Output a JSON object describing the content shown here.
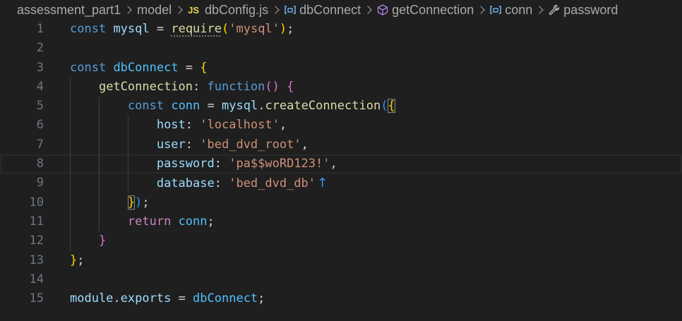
{
  "breadcrumb": {
    "items": [
      {
        "label": "assessment_part1",
        "icon": ""
      },
      {
        "label": "model",
        "icon": ""
      },
      {
        "label": "dbConfig.js",
        "icon": "js-file-icon",
        "badge": "JS"
      },
      {
        "label": "dbConnect",
        "icon": "variable-icon"
      },
      {
        "label": "getConnection",
        "icon": "method-cube-icon"
      },
      {
        "label": "conn",
        "icon": "variable-icon"
      },
      {
        "label": "password",
        "icon": "wrench-property-icon"
      }
    ]
  },
  "editor": {
    "current_line": 8,
    "lines": [
      {
        "n": "1",
        "t": [
          [
            "kw",
            "const"
          ],
          [
            "plain",
            " "
          ],
          [
            "var",
            "mysql"
          ],
          [
            "plain",
            " = "
          ],
          [
            "fn",
            "require"
          ],
          [
            "b1",
            "("
          ],
          [
            "str",
            "'mysql'"
          ],
          [
            "b1",
            ")"
          ],
          [
            "plain",
            ";"
          ]
        ]
      },
      {
        "n": "2",
        "t": []
      },
      {
        "n": "3",
        "t": [
          [
            "kw",
            "const"
          ],
          [
            "plain",
            " "
          ],
          [
            "cst",
            "dbConnect"
          ],
          [
            "plain",
            " = "
          ],
          [
            "b1",
            "{"
          ]
        ]
      },
      {
        "n": "4",
        "t": [
          [
            "plain",
            "    "
          ],
          [
            "fn",
            "getConnection"
          ],
          [
            "plain",
            ": "
          ],
          [
            "kw",
            "function"
          ],
          [
            "b2",
            "()"
          ],
          [
            "plain",
            " "
          ],
          [
            "b2",
            "{"
          ]
        ]
      },
      {
        "n": "5",
        "t": [
          [
            "plain",
            "        "
          ],
          [
            "kw",
            "const"
          ],
          [
            "plain",
            " "
          ],
          [
            "cst",
            "conn"
          ],
          [
            "plain",
            " = "
          ],
          [
            "var",
            "mysql"
          ],
          [
            "plain",
            "."
          ],
          [
            "fn",
            "createConnection"
          ],
          [
            "b3",
            "("
          ],
          [
            "b1m",
            "{"
          ]
        ]
      },
      {
        "n": "6",
        "t": [
          [
            "plain",
            "            "
          ],
          [
            "var",
            "host"
          ],
          [
            "plain",
            ": "
          ],
          [
            "str",
            "'localhost'"
          ],
          [
            "plain",
            ","
          ]
        ]
      },
      {
        "n": "7",
        "t": [
          [
            "plain",
            "            "
          ],
          [
            "var",
            "user"
          ],
          [
            "plain",
            ": "
          ],
          [
            "str",
            "'bed_dvd_root'"
          ],
          [
            "plain",
            ","
          ]
        ]
      },
      {
        "n": "8",
        "t": [
          [
            "plain",
            "            "
          ],
          [
            "var",
            "password"
          ],
          [
            "plain",
            ": "
          ],
          [
            "str",
            "'pa$$woRD123!'"
          ],
          [
            "plain",
            ","
          ]
        ]
      },
      {
        "n": "9",
        "t": [
          [
            "plain",
            "            "
          ],
          [
            "var",
            "database"
          ],
          [
            "plain",
            ": "
          ],
          [
            "str",
            "'bed_dvd_db'"
          ],
          [
            "cursor",
            "↑"
          ]
        ]
      },
      {
        "n": "10",
        "t": [
          [
            "plain",
            "        "
          ],
          [
            "b1m",
            "}"
          ],
          [
            "b3",
            ")"
          ],
          [
            "plain",
            ";"
          ]
        ]
      },
      {
        "n": "11",
        "t": [
          [
            "plain",
            "        "
          ],
          [
            "kw2",
            "return"
          ],
          [
            "plain",
            " "
          ],
          [
            "cst",
            "conn"
          ],
          [
            "plain",
            ";"
          ]
        ]
      },
      {
        "n": "12",
        "t": [
          [
            "plain",
            "    "
          ],
          [
            "b2",
            "}"
          ]
        ]
      },
      {
        "n": "13",
        "t": [
          [
            "b1",
            "}"
          ],
          [
            "plain",
            ";"
          ]
        ]
      },
      {
        "n": "14",
        "t": []
      },
      {
        "n": "15",
        "t": [
          [
            "var",
            "module"
          ],
          [
            "plain",
            "."
          ],
          [
            "var",
            "exports"
          ],
          [
            "plain",
            " = "
          ],
          [
            "cst",
            "dbConnect"
          ],
          [
            "plain",
            ";"
          ]
        ]
      }
    ]
  },
  "colors": {
    "background": "#1f1f1f",
    "keyword": "#569cd6",
    "string": "#ce9178",
    "function": "#dcdcaa",
    "variable": "#9cdcfe",
    "bracket_gold": "#ffd700",
    "bracket_orchid": "#da70d6",
    "bracket_blue": "#179fff"
  }
}
